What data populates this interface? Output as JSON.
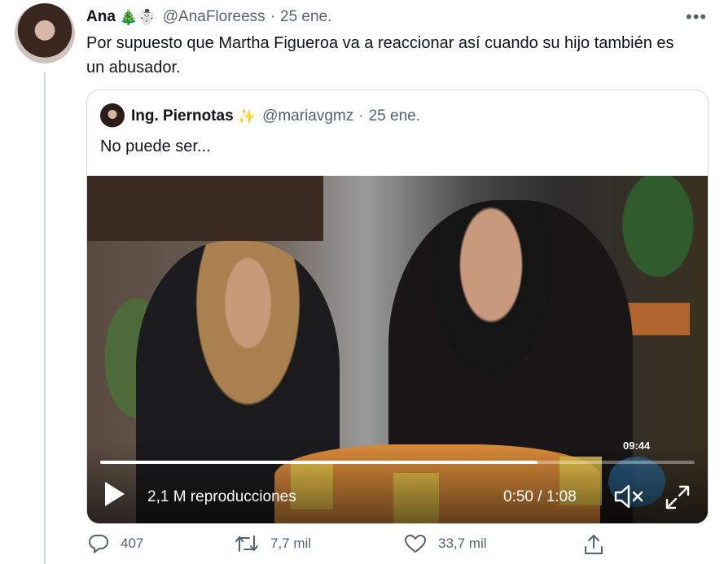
{
  "tweet": {
    "author_name": "Ana",
    "author_emojis": "🎄☃️",
    "handle": "@AnaFloreess",
    "separator": "·",
    "date": "25 ene.",
    "more": "•••",
    "text": "Por supuesto que Martha Figueroa va a reaccionar así cuando su hijo también es un abusador."
  },
  "quoted": {
    "author_name": "Ing. Piernotas",
    "author_emoji": "✨",
    "handle": "@mariavgmz",
    "separator": "·",
    "date": "25 ene.",
    "text": "No puede ser...",
    "video": {
      "overlay_clock": "09:44",
      "views": "2,1 M reproducciones",
      "time_display": "0:50 / 1:08",
      "progress": 0.735
    }
  },
  "actions": {
    "reply_count": "407",
    "retweet_count": "7,7 mil",
    "like_count": "33,7 mil"
  },
  "colors": {
    "text": "#0f1419",
    "muted": "#536471",
    "border": "#cfd9de"
  }
}
